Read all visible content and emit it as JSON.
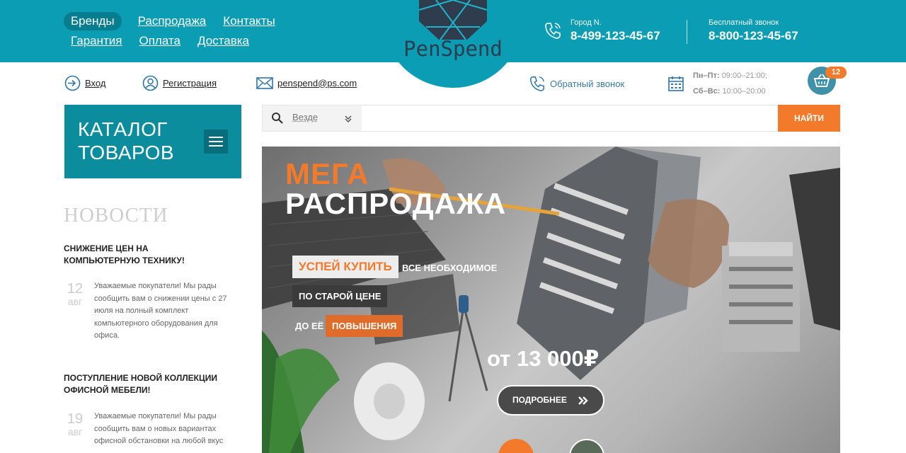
{
  "nav": {
    "row1": [
      "Бренды",
      "Распродажа",
      "Контакты"
    ],
    "row2": [
      "Гарантия",
      "Оплата",
      "Доставка"
    ]
  },
  "logo": {
    "text": "PenSpend"
  },
  "contacts": {
    "city_label": "Город N.",
    "city_phone": "8-499-123-45-67",
    "free_label": "Бесплатный звонок",
    "free_phone": "8-800-123-45-67"
  },
  "toolbar": {
    "login": "Вход",
    "register": "Регистрация",
    "email": "penspend@ps.com",
    "callback": "Обратный звонок",
    "hours_weekdays_label": "Пн–Пт:",
    "hours_weekdays": "09:00–21:00;",
    "hours_weekend_label": "Сб–Вс:",
    "hours_weekend": "10:00–20:00",
    "cart_count": "12"
  },
  "catalog": {
    "title_line1": "КАТАЛОГ",
    "title_line2": "ТОВАРОВ"
  },
  "news": {
    "heading": "НОВОСТИ",
    "items": [
      {
        "title": "СНИЖЕНИЕ ЦЕН НА КОМПЬЮТЕРНУЮ ТЕХНИКУ!",
        "day": "12",
        "month": "авг",
        "text": "Уважаемые покупатели! Мы рады сообщить вам о снижении цены с 27 июля на полный комплект компьютерного оборудования для офиса."
      },
      {
        "title": "ПОСТУПЛЕНИЕ НОВОЙ КОЛЛЕКЦИИ ОФИСНОЙ МЕБЕЛИ!",
        "day": "19",
        "month": "авг",
        "text": "Уважаемые покупатели! Мы рады сообщить вам о новых вариантах офисной обстановки на любой вкус"
      }
    ]
  },
  "search": {
    "scope": "Везде",
    "placeholder": "",
    "button": "НАЙТИ"
  },
  "banner": {
    "title1": "МЕГА",
    "title2": "РАСПРОДАЖА",
    "tag_hurry": "УСПЕЙ КУПИТЬ",
    "tag_all": "ВСЕ НЕОБХОДИМОЕ",
    "tag_old_price": "ПО СТАРОЙ ЦЕНЕ",
    "tag_before": "ДО ЕЁ",
    "tag_raise": "ПОВЫШЕНИЯ",
    "price": "от 13 000₽",
    "more_button": "ПОДРОБНЕЕ"
  },
  "colors": {
    "teal": "#0b9db3",
    "dark_teal": "#0c8d9e",
    "orange": "#f37a2b"
  }
}
